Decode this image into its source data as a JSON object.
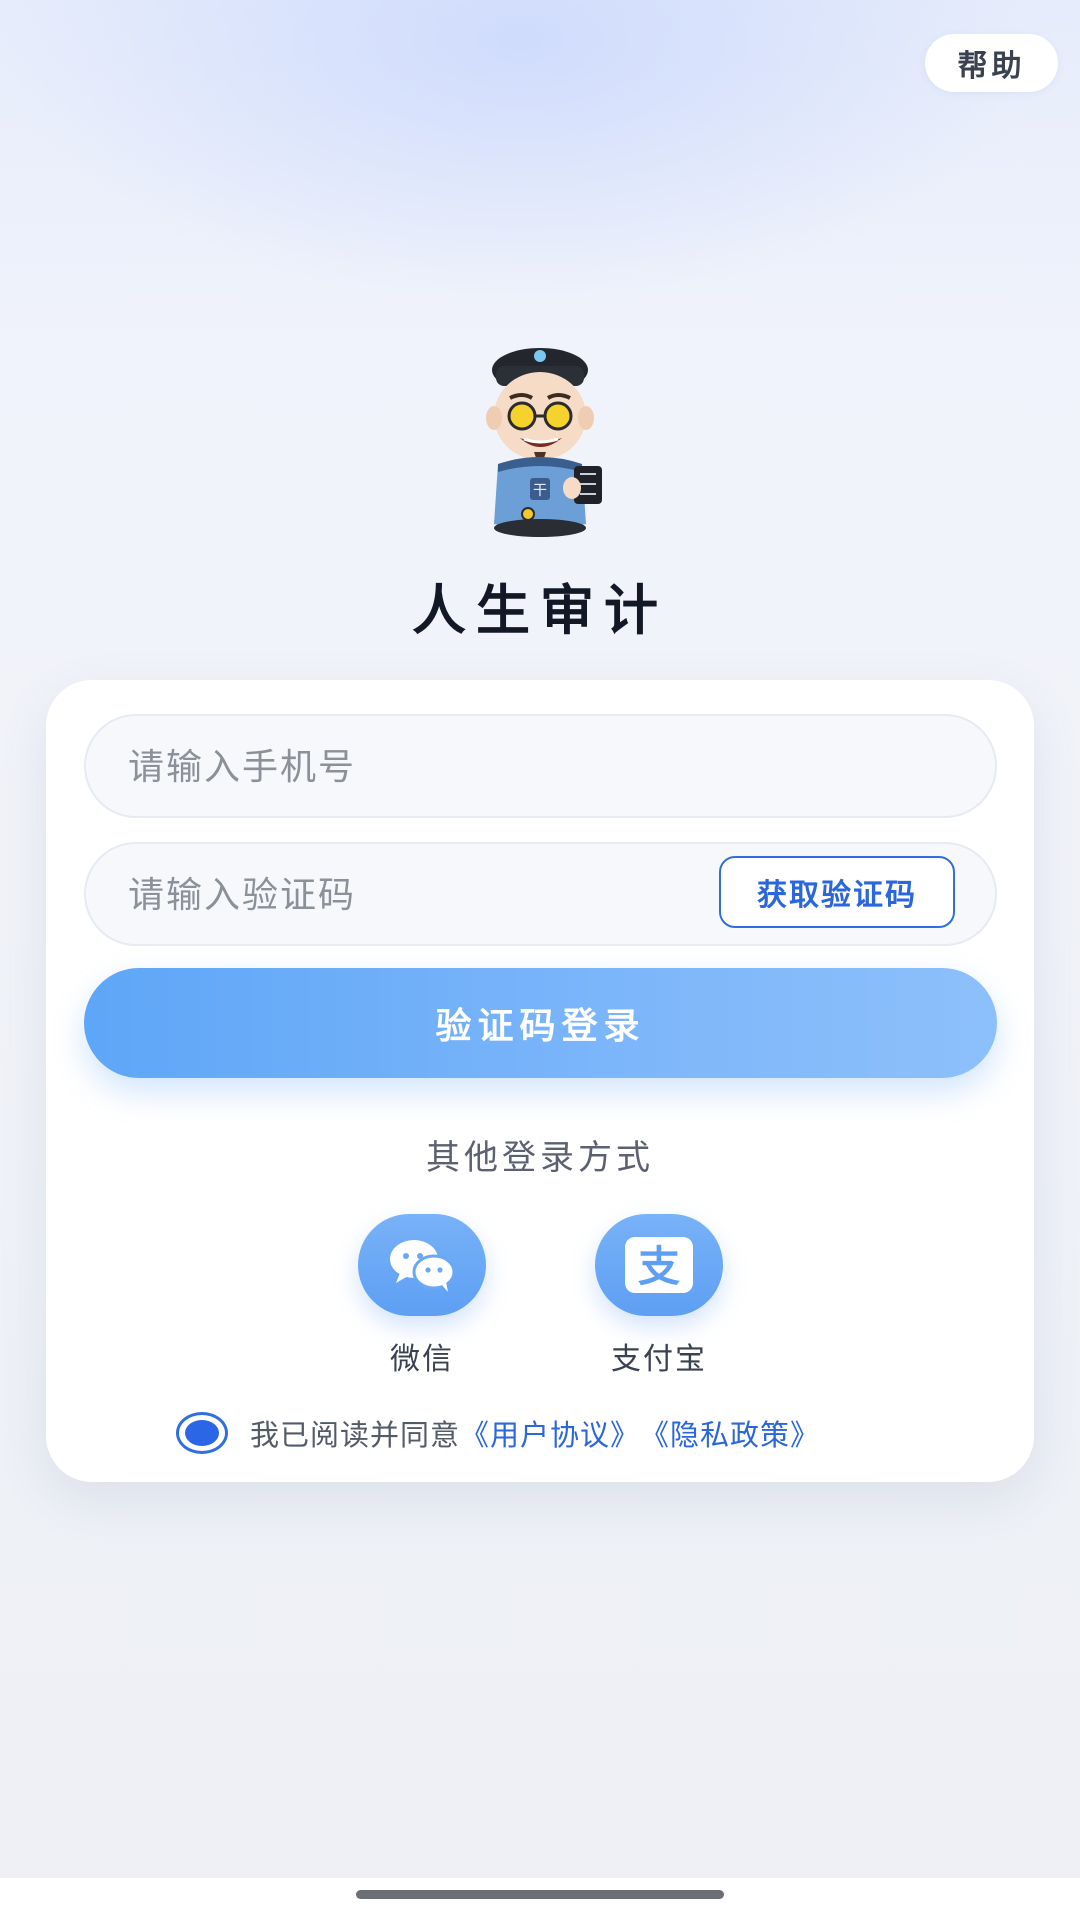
{
  "header": {
    "help_label": "帮助"
  },
  "app": {
    "title": "人生审计",
    "mascot_icon": "auditor-mascot-icon"
  },
  "login_form": {
    "phone_placeholder": "请输入手机号",
    "code_placeholder": "请输入验证码",
    "get_code_label": "获取验证码",
    "submit_label": "验证码登录"
  },
  "other_login": {
    "title": "其他登录方式",
    "options": [
      {
        "label": "微信",
        "icon": "wechat-icon"
      },
      {
        "label": "支付宝",
        "icon": "alipay-icon"
      }
    ]
  },
  "agreement": {
    "prefix": "我已阅读并同意",
    "user_agreement": "《用户协议》",
    "privacy_policy": "《隐私政策》",
    "checked": true
  },
  "colors": {
    "accent": "#2f6fe0",
    "button_gradient_start": "#5ea6f7",
    "button_gradient_end": "#8dc0fb",
    "title": "#121826"
  }
}
